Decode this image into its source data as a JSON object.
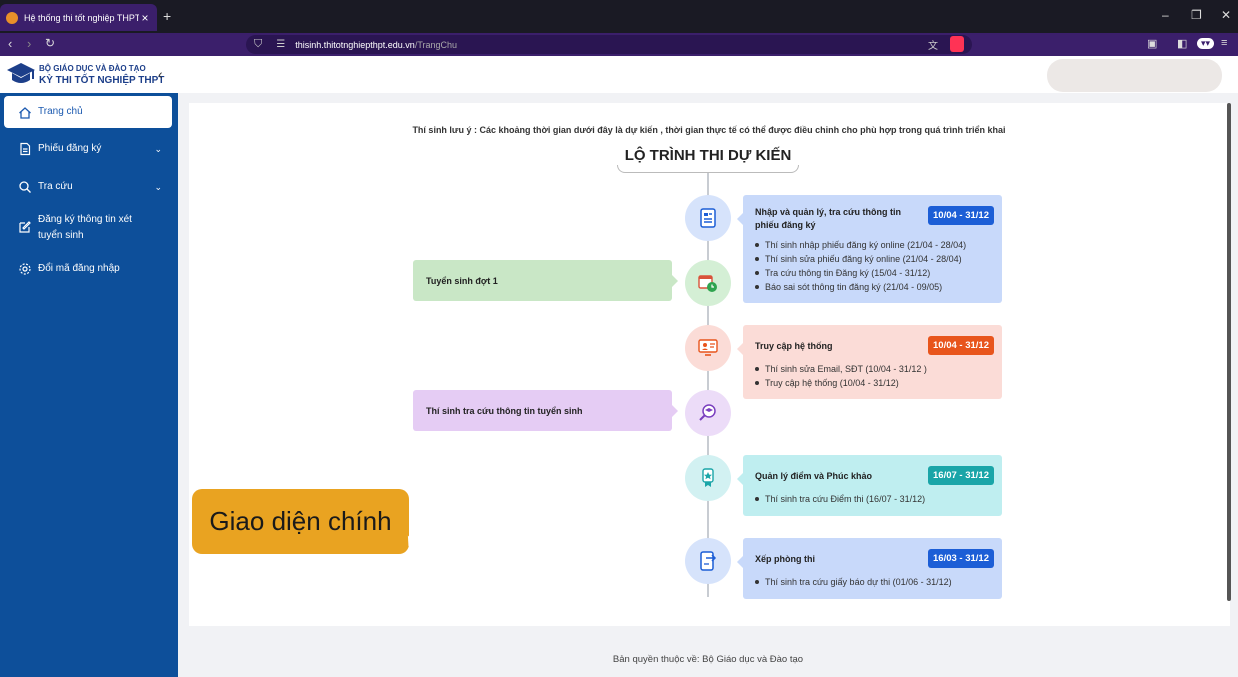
{
  "browser": {
    "tab_title": "Hệ thống thi tốt nghiệp THPT",
    "url_host": "thisinh.thitotnghiepthpt.edu.vn",
    "url_path": "/TrangChu"
  },
  "header": {
    "org_line": "BỘ GIÁO DỤC VÀ ĐÀO TẠO",
    "app_line": "KỲ THI TỐT NGHIỆP THPT"
  },
  "sidebar": {
    "items": [
      {
        "label": "Trang chủ",
        "icon": "home-icon"
      },
      {
        "label": "Phiếu đăng ký",
        "icon": "document-icon"
      },
      {
        "label": "Tra cứu",
        "icon": "search-icon"
      },
      {
        "label": "Đăng ký thông tin xét tuyển sinh",
        "icon": "edit-icon"
      },
      {
        "label": "Đổi mã đăng nhập",
        "icon": "gear-icon"
      }
    ]
  },
  "main": {
    "notice": "Thí sinh lưu ý : Các khoảng thời gian dưới đây là dự kiến , thời gian thực tế có thể được điều chỉnh cho phù hợp trong quá trình triển khai",
    "heading": "LỘ TRÌNH THI DỰ KIẾN",
    "cards": [
      {
        "title": "Nhập và quản lý, tra cứu thông tin phiếu đăng ký",
        "date": "10/04 - 31/12",
        "items": [
          "Thí sinh nhập phiếu đăng ký online (21/04 - 28/04)",
          "Thí sinh sửa phiếu đăng ký online (21/04 - 28/04)",
          "Tra cứu thông tin Đăng ký (15/04 - 31/12)",
          "Báo sai sót thông tin đăng ký (21/04 - 09/05)"
        ]
      },
      {
        "title": "Truy cập hệ thống",
        "date": "10/04 - 31/12",
        "items": [
          "Thí sinh sửa Email, SĐT (10/04 - 31/12 )",
          "Truy cập hệ thống (10/04 - 31/12)"
        ]
      },
      {
        "title": "Quản lý điểm và Phúc khảo",
        "date": "16/07 - 31/12",
        "items": [
          "Thí sinh tra cứu Điểm thi (16/07 - 31/12)"
        ]
      },
      {
        "title": "Xếp phòng thi",
        "date": "16/03 - 31/12",
        "items": [
          "Thí sinh tra cứu giấy báo dự thi (01/06 - 31/12)"
        ]
      }
    ],
    "left_cards": [
      {
        "title": "Tuyển sinh đợt 1"
      },
      {
        "title": "Thí sinh tra cứu thông tin tuyển sinh"
      }
    ]
  },
  "footer": {
    "copyright": "Bản quyền thuộc về: Bộ Giáo dục và Đào tạo"
  },
  "overlay": {
    "label": "Giao diện chính"
  },
  "colors": {
    "sidebar_bg": "#0d4f9a",
    "badge_blue": "#1c5ed6",
    "badge_red": "#e8551c",
    "badge_teal": "#1aa5a8"
  }
}
